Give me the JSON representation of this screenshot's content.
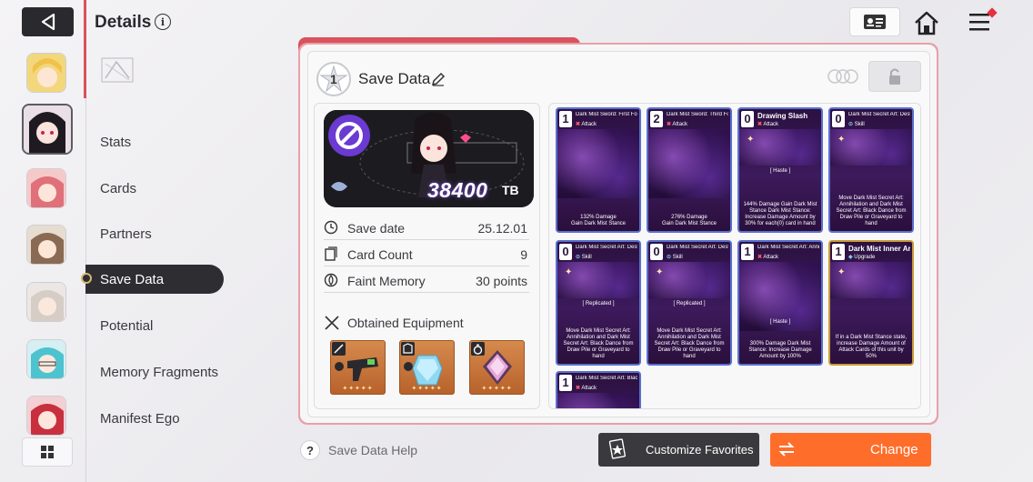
{
  "header": {
    "title": "Details",
    "info_symbol": "i"
  },
  "nav": {
    "items": [
      {
        "label": "Stats"
      },
      {
        "label": "Cards"
      },
      {
        "label": "Partners"
      },
      {
        "label": "Save Data"
      },
      {
        "label": "Potential"
      },
      {
        "label": "Memory Fragments"
      },
      {
        "label": "Manifest Ego"
      }
    ],
    "active_index": 3
  },
  "avatars": [
    {
      "name": "blonde-character"
    },
    {
      "name": "dark-hair-character",
      "selected": true
    },
    {
      "name": "pink-hair-character"
    },
    {
      "name": "brown-hair-character"
    },
    {
      "name": "silver-hair-character"
    },
    {
      "name": "teal-hair-character"
    },
    {
      "name": "red-hair-character"
    }
  ],
  "save": {
    "slot_number": "1",
    "title": "Save Data",
    "banner_value": "38400",
    "banner_unit": "TB",
    "stats": [
      {
        "icon": "clock-icon",
        "label": "Save date",
        "value": "25.12.01"
      },
      {
        "icon": "card-stack-icon",
        "label": "Card Count",
        "value": "9"
      },
      {
        "icon": "memory-icon",
        "label": "Faint Memory",
        "value": "30 points"
      }
    ],
    "equipment_label": "Obtained Equipment",
    "equipment": [
      {
        "type": "weapon",
        "name": "blaster"
      },
      {
        "type": "armor",
        "name": "crystal-vest"
      },
      {
        "type": "ring",
        "name": "gem"
      }
    ],
    "equipment_stars": "✦✦✦✦✦"
  },
  "cards": [
    {
      "cost": "1",
      "name": "Dark Mist Sword: First Form",
      "type_mark": "✖",
      "type": "Attack",
      "desc": "132% Damage\nGain Dark Mist Stance",
      "border": "blue"
    },
    {
      "cost": "2",
      "name": "Dark Mist Sword: Third Form",
      "type_mark": "✖",
      "type": "Attack",
      "desc": "276% Damage\nGain Dark Mist Stance",
      "border": "blue"
    },
    {
      "cost": "0",
      "name": "Drawing Slash",
      "type_mark": "✖",
      "type": "Attack",
      "tag": "[ Haste ]",
      "desc": "144% Damage\nGain Dark Mist Stance\nDark Mist Stance: Increase Damage Amount by 30% for each(0) card in hand",
      "border": "blue",
      "big": true
    },
    {
      "cost": "0",
      "name": "Dark Mist Secret Art: Destruction",
      "type_mark": "⊙",
      "type": "Skill",
      "desc": "Move Dark Mist Secret Art: Annihilation and Dark Mist Secret Art: Black Dance from Draw Pile or Graveyard to hand",
      "border": "blue"
    },
    {
      "cost": "0",
      "name": "Dark Mist Secret Art: Destruction",
      "type_mark": "⊙",
      "type": "Skill",
      "tag": "[ Replicated ]",
      "desc": "Move Dark Mist Secret Art: Annihilation and Dark Mist Secret Art: Black Dance from Draw Pile or Graveyard to hand",
      "border": "blue"
    },
    {
      "cost": "0",
      "name": "Dark Mist Secret Art: Destruction",
      "type_mark": "⊙",
      "type": "Skill",
      "tag": "[ Replicated ]",
      "desc": "Move Dark Mist Secret Art: Annihilation and Dark Mist Secret Art: Black Dance from Draw Pile or Graveyard to hand",
      "border": "blue"
    },
    {
      "cost": "1",
      "name": "Dark Mist Secret Art: Annihilation",
      "type_mark": "✖",
      "type": "Attack",
      "tag": "[ Haste ]",
      "desc": "300% Damage\nDark Mist Stance: Increase Damage Amount by 100%",
      "border": "blue"
    },
    {
      "cost": "1",
      "name": "Dark Mist Inner Art",
      "type_mark": "◈",
      "type": "Upgrade",
      "desc": "If in a Dark Mist Stance state, increase Damage Amount of Attack Cards of this unit by 50%",
      "border": "gold",
      "big": true
    },
    {
      "cost": "1",
      "name": "Dark Mist Secret Art: Black Dance",
      "type_mark": "✖",
      "type": "Attack",
      "desc": "",
      "border": "blue"
    }
  ],
  "footer": {
    "help_label": "Save Data Help",
    "help_symbol": "?",
    "favorites_label": "Customize Favorites",
    "change_label": "Change"
  },
  "colors": {
    "accent_red": "#d9535d",
    "change_orange": "#ff6d2a",
    "dark_button": "#3a3a3e"
  }
}
